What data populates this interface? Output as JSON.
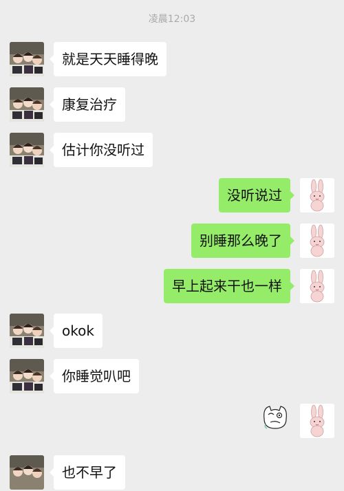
{
  "timestamp": "凌晨12:03",
  "messages": [
    {
      "side": "in",
      "text": "就是天天睡得晚"
    },
    {
      "side": "in",
      "text": "康复治疗"
    },
    {
      "side": "in",
      "text": "估计你没听过"
    },
    {
      "side": "out",
      "text": "没听说过"
    },
    {
      "side": "out",
      "text": "别睡那么晚了"
    },
    {
      "side": "out",
      "text": "早上起来干也一样"
    },
    {
      "side": "in",
      "text": "okok"
    },
    {
      "side": "in",
      "text": "你睡觉叭吧"
    },
    {
      "side": "out",
      "type": "sticker",
      "sticker": "cat-face-sticker"
    },
    {
      "side": "in",
      "text": "也不早了"
    }
  ],
  "avatars": {
    "contact": "anime-group-avatar",
    "self": "pink-rabbit-avatar"
  },
  "colors": {
    "background": "#ededed",
    "incoming_bubble": "#ffffff",
    "outgoing_bubble": "#95ec69",
    "timestamp": "#a9a9a9"
  }
}
